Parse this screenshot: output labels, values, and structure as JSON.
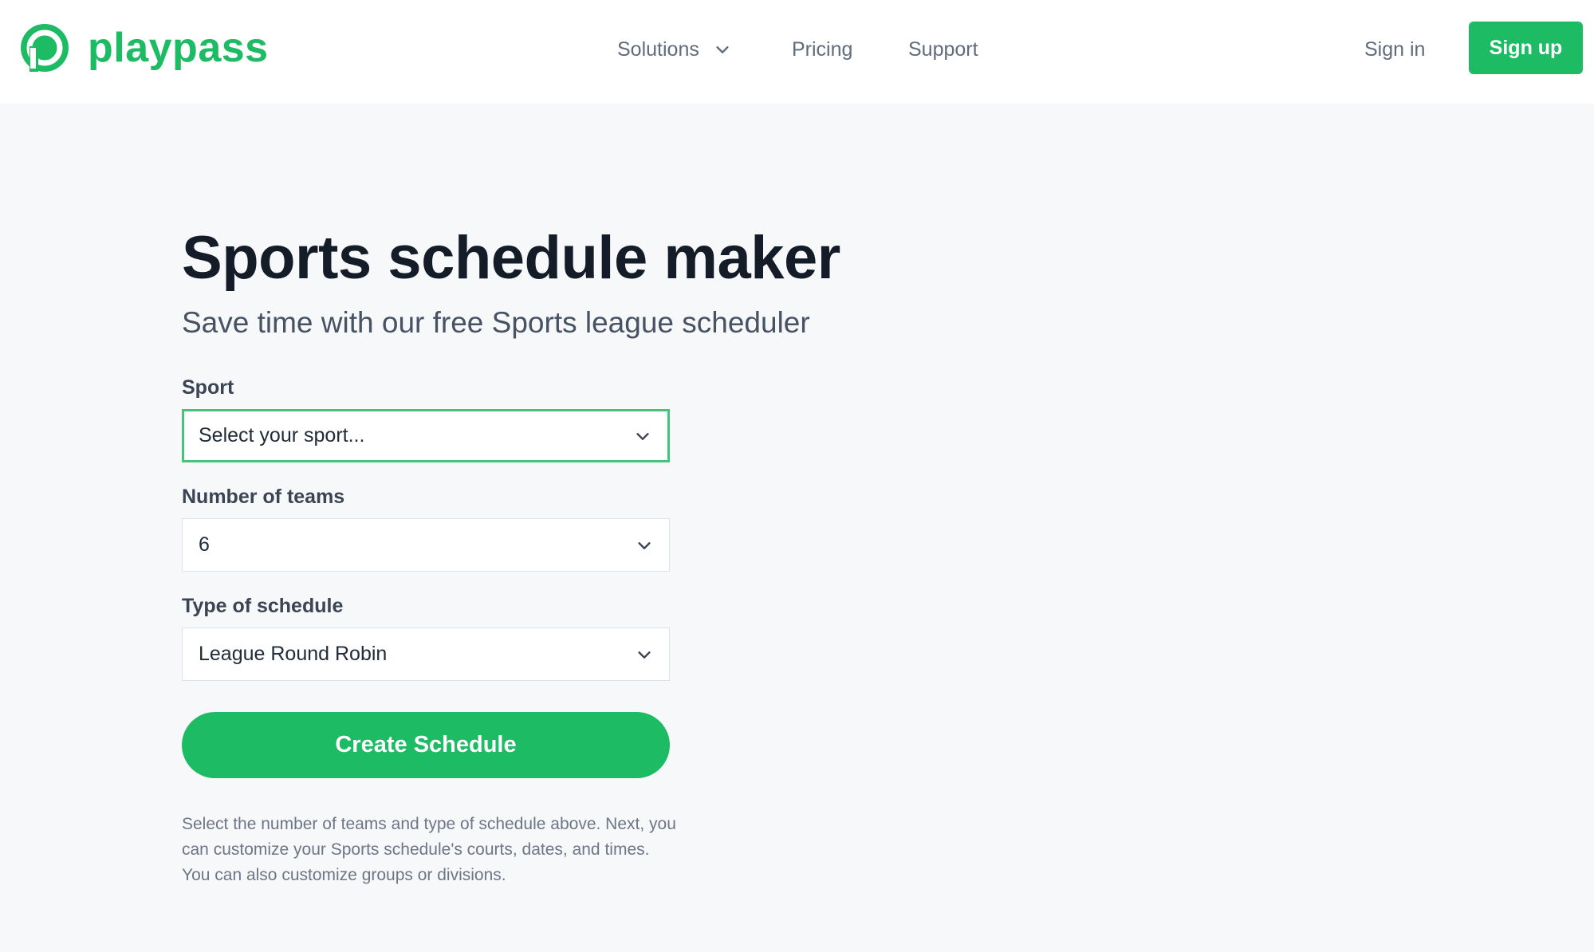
{
  "brand": {
    "name": "playpass",
    "color": "#1dbb63"
  },
  "nav": {
    "solutions": "Solutions",
    "pricing": "Pricing",
    "support": "Support",
    "sign_in": "Sign in",
    "sign_up": "Sign up"
  },
  "hero": {
    "title": "Sports schedule maker",
    "subtitle": "Save time with our free Sports league scheduler"
  },
  "form": {
    "sport": {
      "label": "Sport",
      "value": "Select your sport..."
    },
    "teams": {
      "label": "Number of teams",
      "value": "6"
    },
    "schedule_type": {
      "label": "Type of schedule",
      "value": "League Round Robin"
    },
    "submit": "Create Schedule",
    "help": "Select the number of teams and type of schedule above. Next, you can customize your Sports schedule's courts, dates, and times. You can also customize groups or divisions."
  },
  "icons": {
    "logo": "playpass-logo-icon",
    "dropdown": "chevron-down-icon"
  }
}
